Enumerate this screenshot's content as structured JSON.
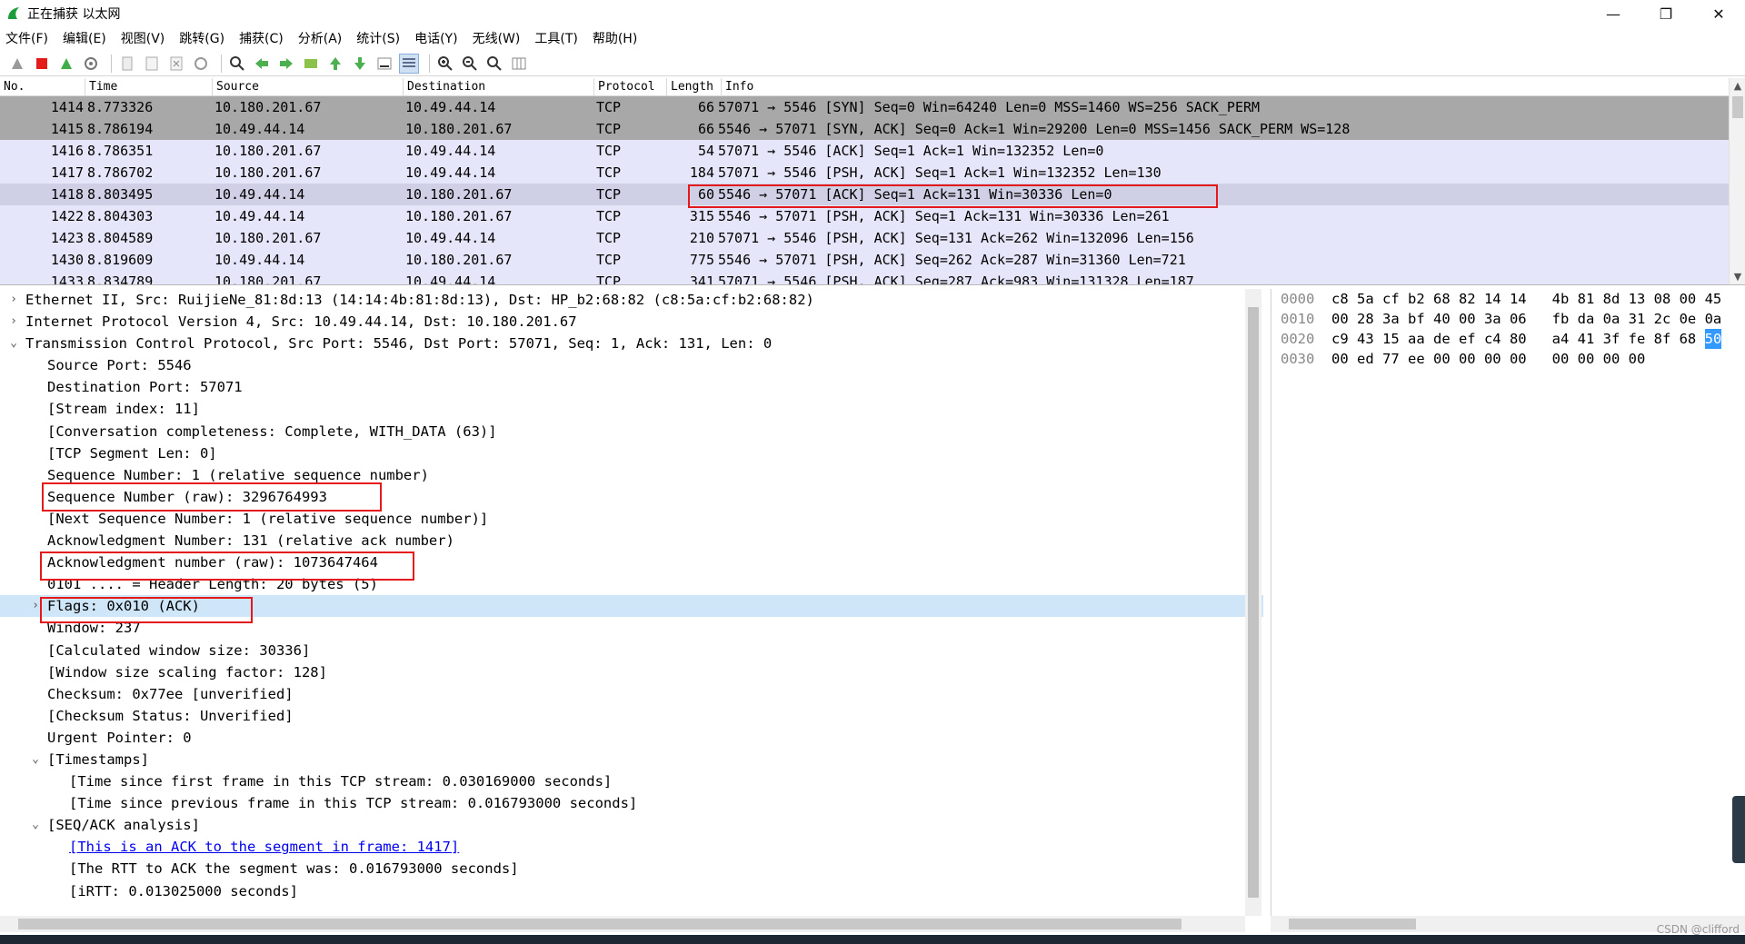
{
  "window": {
    "title": "正在捕获 以太网",
    "controls": [
      "—",
      "❐",
      "✕"
    ]
  },
  "menu": [
    "文件(F)",
    "编辑(E)",
    "视图(V)",
    "跳转(G)",
    "捕获(C)",
    "分析(A)",
    "统计(S)",
    "电话(Y)",
    "无线(W)",
    "工具(T)",
    "帮助(H)"
  ],
  "packet_list": {
    "headers": [
      "No.",
      "Time",
      "Source",
      "Destination",
      "Protocol",
      "Length",
      "Info"
    ],
    "rows": [
      {
        "no": "1414",
        "time": "8.773326",
        "src": "10.180.201.67",
        "dst": "10.49.44.14",
        "proto": "TCP",
        "len": "66",
        "info": "57071 → 5546 [SYN] Seq=0 Win=64240 Len=0 MSS=1460 WS=256 SACK_PERM",
        "style": "gray"
      },
      {
        "no": "1415",
        "time": "8.786194",
        "src": "10.49.44.14",
        "dst": "10.180.201.67",
        "proto": "TCP",
        "len": "66",
        "info": "5546 → 57071 [SYN, ACK] Seq=0 Ack=1 Win=29200 Len=0 MSS=1456 SACK_PERM WS=128",
        "style": "gray"
      },
      {
        "no": "1416",
        "time": "8.786351",
        "src": "10.180.201.67",
        "dst": "10.49.44.14",
        "proto": "TCP",
        "len": "54",
        "info": "57071 → 5546 [ACK] Seq=1 Ack=1 Win=132352 Len=0",
        "style": "lav"
      },
      {
        "no": "1417",
        "time": "8.786702",
        "src": "10.180.201.67",
        "dst": "10.49.44.14",
        "proto": "TCP",
        "len": "184",
        "info": "57071 → 5546 [PSH, ACK] Seq=1 Ack=1 Win=132352 Len=130",
        "style": "lav"
      },
      {
        "no": "1418",
        "time": "8.803495",
        "src": "10.49.44.14",
        "dst": "10.180.201.67",
        "proto": "TCP",
        "len": "60",
        "info": "5546 → 57071 [ACK] Seq=1 Ack=131 Win=30336 Len=0",
        "style": "sel"
      },
      {
        "no": "1422",
        "time": "8.804303",
        "src": "10.49.44.14",
        "dst": "10.180.201.67",
        "proto": "TCP",
        "len": "315",
        "info": "5546 → 57071 [PSH, ACK] Seq=1 Ack=131 Win=30336 Len=261",
        "style": "lav"
      },
      {
        "no": "1423",
        "time": "8.804589",
        "src": "10.180.201.67",
        "dst": "10.49.44.14",
        "proto": "TCP",
        "len": "210",
        "info": "57071 → 5546 [PSH, ACK] Seq=131 Ack=262 Win=132096 Len=156",
        "style": "lav"
      },
      {
        "no": "1430",
        "time": "8.819609",
        "src": "10.49.44.14",
        "dst": "10.180.201.67",
        "proto": "TCP",
        "len": "775",
        "info": "5546 → 57071 [PSH, ACK] Seq=262 Ack=287 Win=31360 Len=721",
        "style": "lav"
      },
      {
        "no": "1433",
        "time": "8.834789",
        "src": "10.180.201.67",
        "dst": "10.49.44.14",
        "proto": "TCP",
        "len": "341",
        "info": "57071 → 5546 [PSH, ACK] Seq=287 Ack=983 Win=131328 Len=187",
        "style": "lav"
      }
    ]
  },
  "details": [
    {
      "text": "Ethernet II, Src: RuijieNe_81:8d:13 (14:14:4b:81:8d:13), Dst: HP_b2:68:82 (c8:5a:cf:b2:68:82)",
      "indent": 0,
      "arrow": "›"
    },
    {
      "text": "Internet Protocol Version 4, Src: 10.49.44.14, Dst: 10.180.201.67",
      "indent": 0,
      "arrow": "›"
    },
    {
      "text": "Transmission Control Protocol, Src Port: 5546, Dst Port: 57071, Seq: 1, Ack: 131, Len: 0",
      "indent": 0,
      "arrow": "⌄"
    },
    {
      "text": "Source Port: 5546",
      "indent": 1
    },
    {
      "text": "Destination Port: 57071",
      "indent": 1
    },
    {
      "text": "[Stream index: 11]",
      "indent": 1
    },
    {
      "text": "[Conversation completeness: Complete, WITH_DATA (63)]",
      "indent": 1
    },
    {
      "text": "[TCP Segment Len: 0]",
      "indent": 1
    },
    {
      "text": "Sequence Number: 1    (relative sequence number)",
      "indent": 1
    },
    {
      "text": "Sequence Number (raw): 3296764993",
      "indent": 1
    },
    {
      "text": "[Next Sequence Number: 1    (relative sequence number)]",
      "indent": 1
    },
    {
      "text": "Acknowledgment Number: 131    (relative ack number)",
      "indent": 1
    },
    {
      "text": "Acknowledgment number (raw): 1073647464",
      "indent": 1
    },
    {
      "text": "0101 .... = Header Length: 20 bytes (5)",
      "indent": 1
    },
    {
      "text": "Flags: 0x010 (ACK)",
      "indent": 1,
      "arrow": "›",
      "highlight": true
    },
    {
      "text": "Window: 237",
      "indent": 1
    },
    {
      "text": "[Calculated window size: 30336]",
      "indent": 1
    },
    {
      "text": "[Window size scaling factor: 128]",
      "indent": 1
    },
    {
      "text": "Checksum: 0x77ee [unverified]",
      "indent": 1
    },
    {
      "text": "[Checksum Status: Unverified]",
      "indent": 1
    },
    {
      "text": "Urgent Pointer: 0",
      "indent": 1
    },
    {
      "text": "[Timestamps]",
      "indent": 1,
      "arrow": "⌄"
    },
    {
      "text": "[Time since first frame in this TCP stream: 0.030169000 seconds]",
      "indent": 2
    },
    {
      "text": "[Time since previous frame in this TCP stream: 0.016793000 seconds]",
      "indent": 2
    },
    {
      "text": "[SEQ/ACK analysis]",
      "indent": 1,
      "arrow": "⌄"
    },
    {
      "text": "[This is an ACK to the segment in frame: 1417]",
      "indent": 2,
      "link": true
    },
    {
      "text": "[The RTT to ACK the segment was: 0.016793000 seconds]",
      "indent": 2
    },
    {
      "text": "[iRTT: 0.013025000 seconds]",
      "indent": 2
    }
  ],
  "hex": [
    {
      "offset": "0000",
      "bytes": "c8 5a cf b2 68 82 14 14   4b 81 8d 13 08 00 45",
      "hl": ""
    },
    {
      "offset": "0010",
      "bytes": "00 28 3a bf 40 00 3a 06   fb da 0a 31 2c 0e 0a",
      "hl": ""
    },
    {
      "offset": "0020",
      "bytes": "c9 43 15 aa de ef c4 80   a4 41 3f fe 8f 68 ",
      "hl": "50"
    },
    {
      "offset": "0030",
      "bytes": "00 ed 77 ee 00 00 00 00   00 00 00 00",
      "hl": ""
    }
  ],
  "watermark": "CSDN @clifford",
  "colors": {
    "gray_row": "#a8a8a8",
    "lavender_row": "#e6e6fa",
    "selected_row": "#cfcfe6",
    "flags_highlight": "#cfe6f9",
    "annotation_red": "#e3191c",
    "hex_highlight": "#3399ff"
  }
}
